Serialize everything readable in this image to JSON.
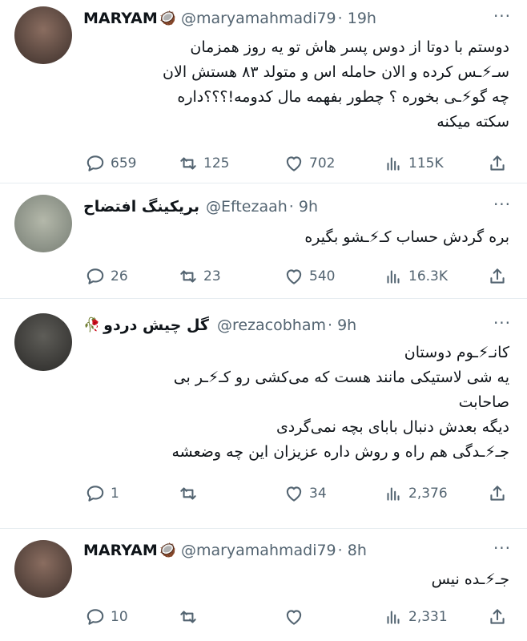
{
  "tweets": [
    {
      "name": "MARYAM",
      "badge_emoji": "🥥",
      "handle": "@maryamahmadi79",
      "time": "· 19h",
      "text_lines": [
        "دوستم با دوتا از دوس پسر هاش تو یه روز همزمان",
        "سـ⚡ـس کرده و الان حامله اس و متولد ۸۳ هستش الان",
        "چه گو⚡ـی بخوره ؟ چطور بفهمه مال کدومه!؟؟؟داره",
        "سکته میکنه"
      ],
      "replies": "659",
      "retweets": "125",
      "likes": "702",
      "views": "115K",
      "avatar_color": "#6e5a50"
    },
    {
      "name": "بریکینگ افتضاح",
      "badge_emoji": "",
      "handle": "@Eftezaah",
      "time": "· 9h",
      "text_lines": [
        "بره گردش حساب کـ⚡ـشو بگیره"
      ],
      "replies": "26",
      "retweets": "23",
      "likes": "540",
      "views": "16.3K",
      "avatar_color": "#9aa092"
    },
    {
      "name": "گل چیش دردو",
      "badge_emoji": "🥀",
      "handle": "@rezacobham",
      "time": "· 9h",
      "text_lines": [
        "کانـ⚡ـوم دوستان",
        "یه شی لاستیکی مانند هست که می‌کشی رو کـ⚡ـر بی",
        "صاحابت",
        "دیگه بعدش دنبال بابای بچه نمی‌گردی",
        "جـ⚡ـدگی هم راه و روش داره عزیزان این چه وضعشه"
      ],
      "replies": "1",
      "retweets": "",
      "likes": "34",
      "views": "2,376",
      "avatar_color": "#4a4a46"
    },
    {
      "name": "MARYAM",
      "badge_emoji": "🥥",
      "handle": "@maryamahmadi79",
      "time": "· 8h",
      "text_lines": [
        "جـ⚡ـده نیس"
      ],
      "replies": "10",
      "retweets": "",
      "likes": "",
      "views": "2,331",
      "avatar_color": "#6e5a50"
    }
  ],
  "icons": {
    "reply": "reply-icon",
    "retweet": "retweet-icon",
    "like": "heart-icon",
    "views": "views-icon",
    "share": "share-icon",
    "more": "more-icon"
  },
  "colors": {
    "text": "#0f1419",
    "secondary": "#536471",
    "divider": "#e6ecf0"
  }
}
